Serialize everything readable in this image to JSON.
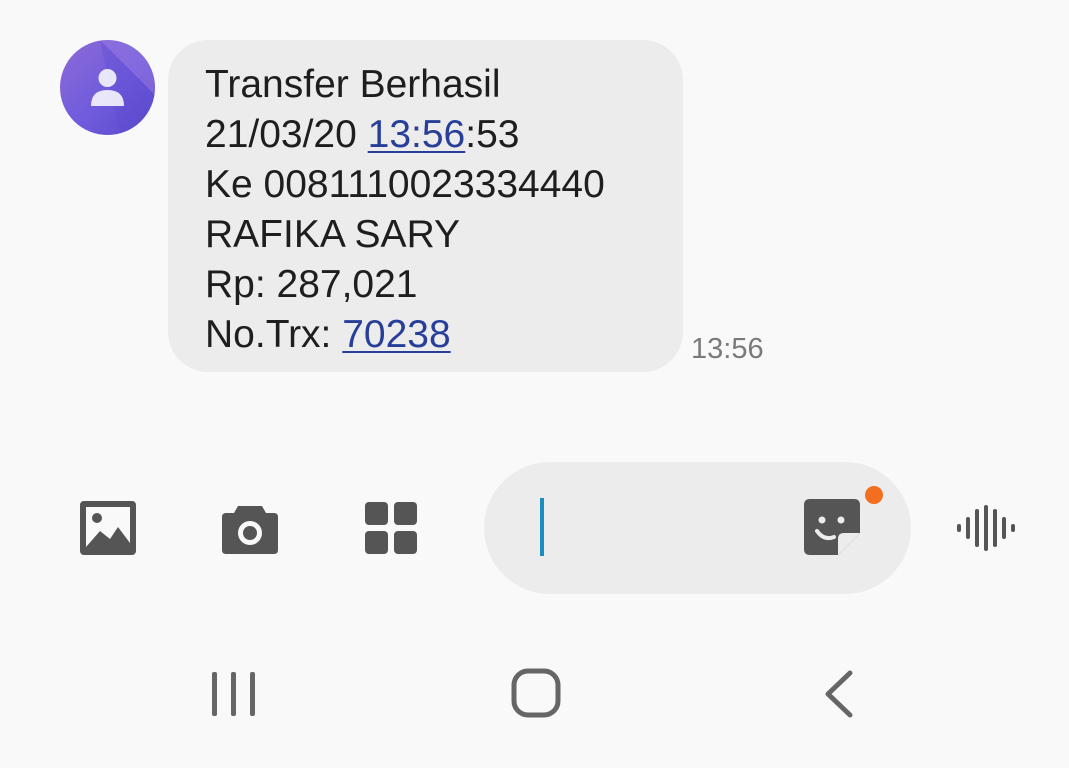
{
  "conversation": {
    "contact_avatar_icon": "person-icon",
    "message": {
      "heading": "Transfer Berhasil",
      "date_text": "21/03/20 ",
      "time_link": "13:56",
      "seconds_text": ":53",
      "recipient_line": "Ke 0081110023334440",
      "recipient_name": "RAFIKA SARY",
      "amount_line": "Rp: 287,021",
      "trx_label": "No.Trx: ",
      "trx_link": "70238"
    },
    "message_time": "13:56"
  },
  "composer": {
    "gallery_icon": "image-icon",
    "camera_icon": "camera-icon",
    "apps_icon": "apps-grid-icon",
    "sticker_icon": "sticker-icon",
    "voice_icon": "voice-wave-icon",
    "input_value": "",
    "accent_color": "#1a8fbf",
    "notification_dot_color": "#f26f1f"
  },
  "navigation_bar": {
    "recents_icon": "recents-icon",
    "home_icon": "home-icon",
    "back_icon": "back-icon"
  },
  "colors": {
    "background": "#f9f9f9",
    "bubble": "#ececec",
    "link": "#283f9a",
    "avatar": "#7a5fd9"
  }
}
